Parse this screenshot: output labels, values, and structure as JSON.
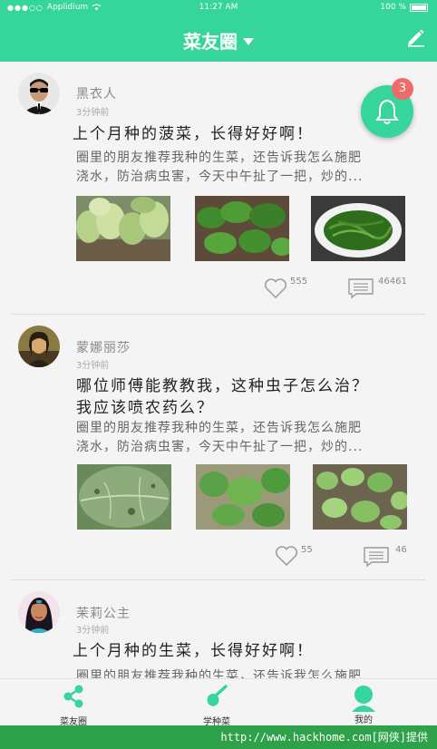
{
  "status_bar": {
    "carrier": "Applidium",
    "time": "11:27 AM",
    "battery": "100 %"
  },
  "header": {
    "title": "菜友圈",
    "edit_icon": "pencil-icon"
  },
  "notification": {
    "icon": "bell-icon",
    "badge": "3"
  },
  "posts": [
    {
      "author": "黑衣人",
      "time_ago": "3分钟前",
      "title_lines": [
        "上个月种的菠菜，长得好好啊！"
      ],
      "body_lines": [
        "圈里的朋友推荐我种的生菜，还告诉我怎么施肥",
        "浇水，防治病虫害，今天中午扯了一把，炒的..."
      ],
      "likes": "555",
      "comments": "46461"
    },
    {
      "author": "蒙娜丽莎",
      "time_ago": "3分钟前",
      "title_lines": [
        "哪位师傅能教教我，这种虫子怎么治？",
        "我应该喷农药么？"
      ],
      "body_lines": [
        "圈里的朋友推荐我种的生菜，还告诉我怎么施肥",
        "浇水，防治病虫害，今天中午扯了一把，炒的..."
      ],
      "likes": "55",
      "comments": "46"
    },
    {
      "author": "茉莉公主",
      "time_ago": "3分钟前",
      "title_lines": [
        "上个月种的生菜，长得好好啊！"
      ],
      "body_lines": [
        "圈里的朋友推荐我种的生菜，还告诉我怎么施肥"
      ]
    }
  ],
  "tabs": [
    {
      "label": "菜友圈",
      "icon": "share-icon"
    },
    {
      "label": "学种菜",
      "icon": "trowel-icon"
    },
    {
      "label": "我的",
      "icon": "user-icon"
    }
  ],
  "watermark": "http://www.hackhome.com[网侠]提供",
  "colors": {
    "accent": "#36d59c",
    "badge": "#ef6a6a",
    "watermark_bg": "#2ea24a"
  }
}
